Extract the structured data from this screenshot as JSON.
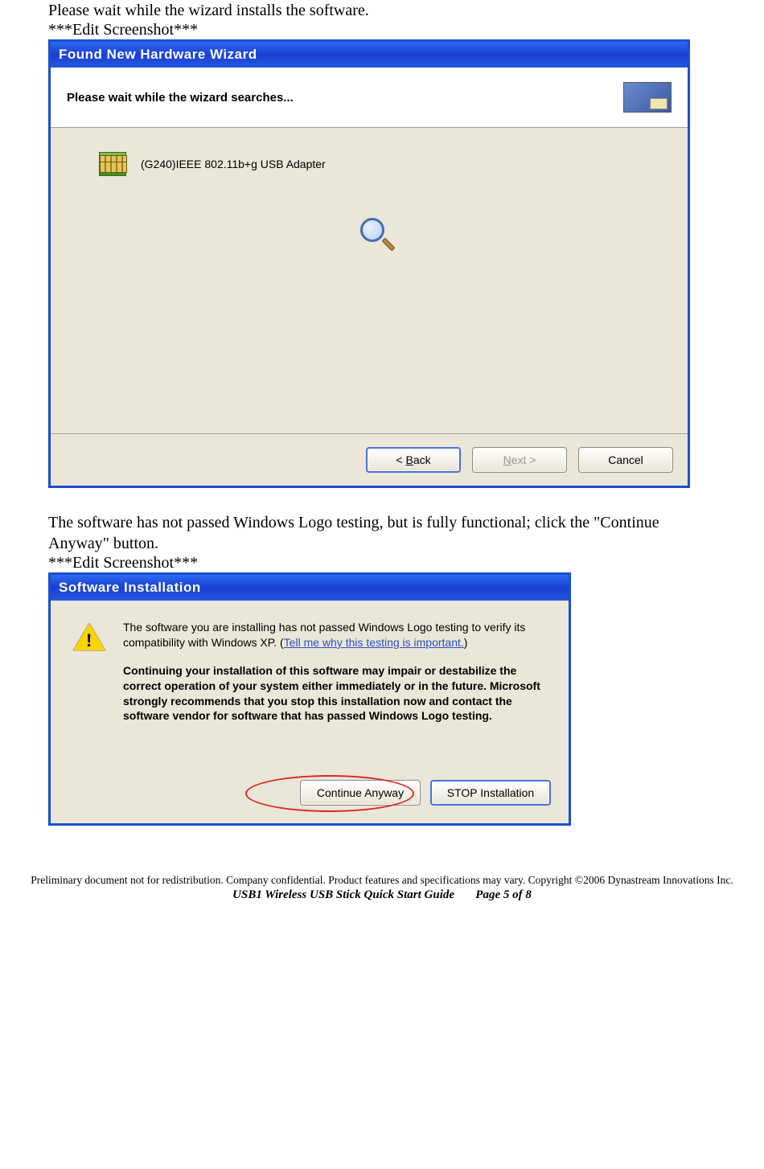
{
  "instruction1": "Please wait while the wizard installs the software.",
  "placeholder1": "***Edit Screenshot***",
  "wizard1": {
    "title": "Found New Hardware Wizard",
    "heading": "Please wait while the wizard searches...",
    "device": "(G240)IEEE 802.11b+g USB Adapter",
    "back": "< Back",
    "next": "Next >",
    "cancel": "Cancel"
  },
  "instruction2": "The software has not passed Windows Logo testing, but is fully functional; click the \"Continue Anyway\" button.",
  "placeholder2": "***Edit Screenshot***",
  "dialog2": {
    "title": "Software Installation",
    "para1a": "The software you are installing has not passed Windows Logo testing to verify its compatibility with Windows XP. (",
    "link": "Tell me why this testing is important.",
    "para1b": ")",
    "bold": "Continuing your installation of this software may impair or destabilize the correct operation of your system either immediately or in the future. Microsoft strongly recommends that you stop this installation now and contact the software vendor for software that has passed Windows Logo testing.",
    "continue": "Continue Anyway",
    "stop": "STOP Installation"
  },
  "footer": {
    "line1": "Preliminary document not for redistribution.  Company confidential.  Product features and specifications may vary. Copyright ©2006 Dynastream Innovations Inc.",
    "title": "USB1 Wireless USB Stick Quick Start Guide",
    "page": "Page 5 of 8"
  }
}
